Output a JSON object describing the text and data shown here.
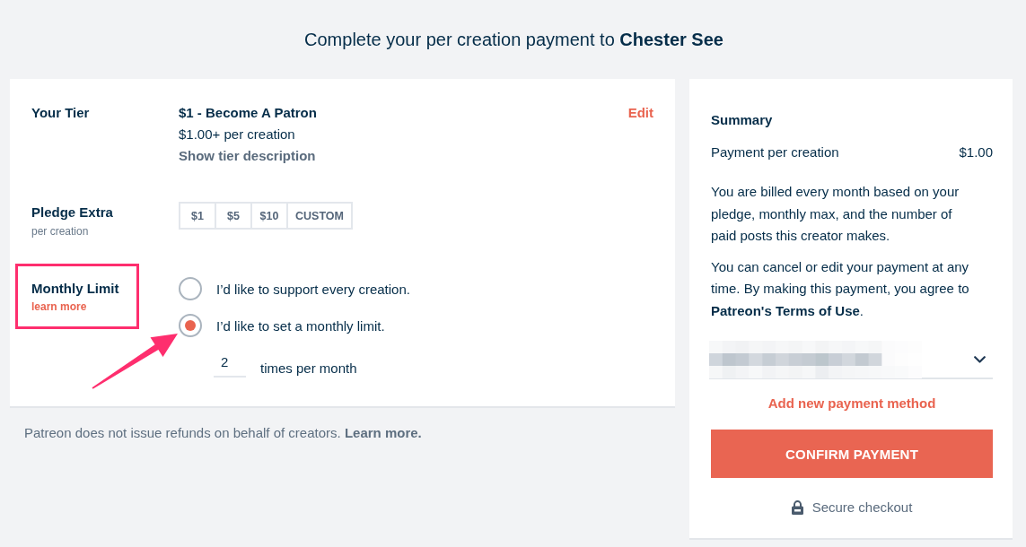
{
  "page_title": "Complete your per creation payment to **Chester See**",
  "tier": {
    "label": "Your Tier",
    "name": "$1 - Become A Patron",
    "price": "$1.00+ per creation",
    "description_link": "Show tier description",
    "edit_link": "Edit"
  },
  "pledge_extra": {
    "label": "Pledge Extra",
    "sublabel": "per creation",
    "options": [
      {
        "label": "$1",
        "selected": false
      },
      {
        "label": "$5",
        "selected": false
      },
      {
        "label": "$10",
        "selected": false
      },
      {
        "label": "CUSTOM",
        "selected": false
      }
    ]
  },
  "monthly_limit": {
    "label": "Monthly Limit",
    "link": "learn more",
    "highlighted": true,
    "options": [
      {
        "label": "I’d like to support every creation.",
        "selected": false
      },
      {
        "label": "I’d like to set a monthly limit.",
        "selected": true
      }
    ],
    "limit_value": "2",
    "limit_unit": "times per month"
  },
  "refund_note": "Patreon does not issue refunds on behalf of creators. **Learn more.**",
  "summary": {
    "title": "Summary",
    "rows": [
      {
        "label": "Payment per creation",
        "value": "$1.00"
      }
    ],
    "billing_note": "You are billed every month based on your pledge, monthly max, and the number of paid posts this creator makes.",
    "terms_note": "You can cancel or edit your payment at any time. By making this payment, you agree to **Patreon's Terms of Use**.",
    "add_payment_link": "Add new payment method",
    "confirm_button": "CONFIRM PAYMENT",
    "secure_note": "Secure checkout"
  }
}
